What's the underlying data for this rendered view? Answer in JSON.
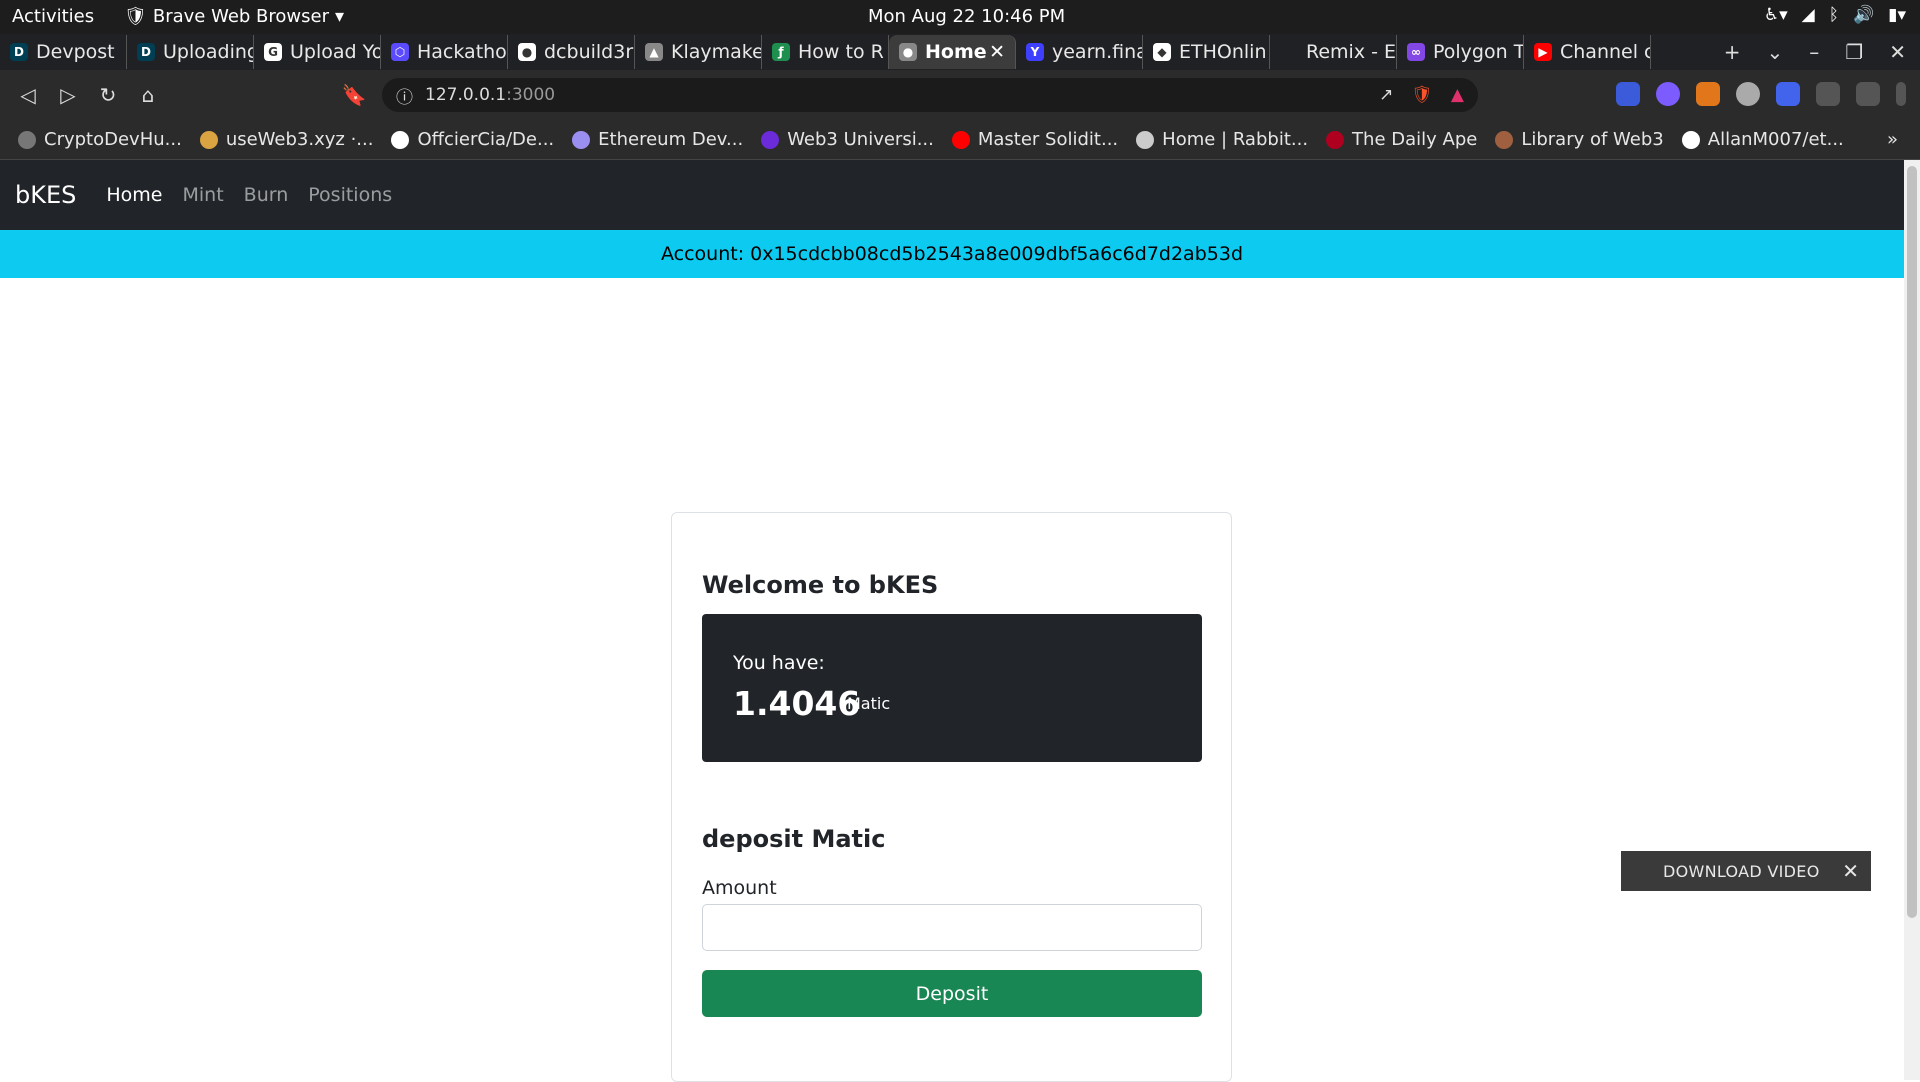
{
  "system": {
    "activities": "Activities",
    "app_name": "Brave Web Browser",
    "clock": "Mon Aug 22  10:46 PM"
  },
  "tabs": [
    {
      "label": "Devpost",
      "color": "#003e54",
      "glyph": "D"
    },
    {
      "label": "Uploading",
      "color": "#003e54",
      "glyph": "D"
    },
    {
      "label": "Upload Yo",
      "color": "#ffffff",
      "glyph": "G"
    },
    {
      "label": "Hackatho",
      "color": "#5b4bff",
      "glyph": "⬡"
    },
    {
      "label": "dcbuild3r",
      "color": "#ffffff",
      "glyph": "●"
    },
    {
      "label": "Klaymake",
      "color": "#888888",
      "glyph": "▲"
    },
    {
      "label": "How to R",
      "color": "#1f8f4f",
      "glyph": "ƒ"
    },
    {
      "label": "Home",
      "color": "#888888",
      "glyph": "●",
      "active": true
    },
    {
      "label": "yearn.fina",
      "color": "#3f3fff",
      "glyph": "Y"
    },
    {
      "label": "ETHOnlin",
      "color": "#ffffff",
      "glyph": "◆"
    },
    {
      "label": "Remix - E",
      "color": "#202124",
      "glyph": " "
    },
    {
      "label": "Polygon T",
      "color": "#8247e5",
      "glyph": "∞"
    },
    {
      "label": "Channel c",
      "color": "#ff0000",
      "glyph": "▶"
    }
  ],
  "address_bar": {
    "host": "127.0.0.1",
    "port": ":3000"
  },
  "bookmarks": [
    {
      "label": "CryptoDevHu...",
      "color": "#777777"
    },
    {
      "label": "useWeb3.xyz ·...",
      "color": "#d9a441"
    },
    {
      "label": "OffcierCia/De...",
      "color": "#ffffff"
    },
    {
      "label": "Ethereum Dev...",
      "color": "#9a8ff0"
    },
    {
      "label": "Web3 Universi...",
      "color": "#6b2bd9"
    },
    {
      "label": "Master Solidit...",
      "color": "#ff0000"
    },
    {
      "label": "Home | Rabbit...",
      "color": "#cccccc"
    },
    {
      "label": "The Daily Ape",
      "color": "#b00020"
    },
    {
      "label": "Library of Web3",
      "color": "#a06040"
    },
    {
      "label": "AllanM007/et...",
      "color": "#ffffff"
    }
  ],
  "app": {
    "brand": "bKES",
    "nav": [
      {
        "label": "Home",
        "active": true
      },
      {
        "label": "Mint",
        "active": false
      },
      {
        "label": "Burn",
        "active": false
      },
      {
        "label": "Positions",
        "active": false
      }
    ],
    "account": "Account: 0x15cdcbb08cd5b2543a8e009dbf5a6c6d7d2ab53d",
    "welcome": "Welcome to bKES",
    "balance_label": "You have:",
    "balance_amount": "1.4046",
    "balance_unit": "Matic",
    "deposit_title": "deposit Matic",
    "amount_label": "Amount",
    "amount_value": "",
    "deposit_button": "Deposit"
  },
  "download_video": "DOWNLOAD VIDEO",
  "colors": {
    "navbar": "#212529",
    "account_bar": "#0dcaf0",
    "deposit_button": "#198754"
  }
}
